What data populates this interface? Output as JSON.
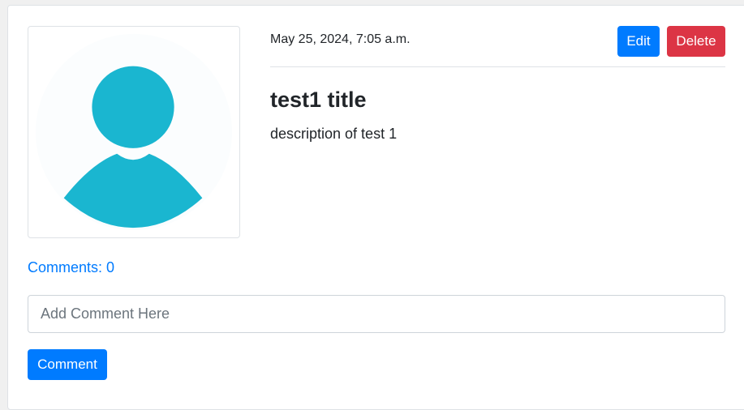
{
  "post": {
    "date": "May 25, 2024, 7:05 a.m.",
    "title": "test1 title",
    "description": "description of test 1",
    "avatar_icon": "user-avatar-icon"
  },
  "actions": {
    "edit_label": "Edit",
    "delete_label": "Delete"
  },
  "comments": {
    "count_label": "Comments: 0",
    "input_placeholder": "Add Comment Here",
    "input_value": "",
    "submit_label": "Comment"
  },
  "colors": {
    "primary": "#007bff",
    "danger": "#dc3545",
    "avatar": "#1ab6d0"
  }
}
